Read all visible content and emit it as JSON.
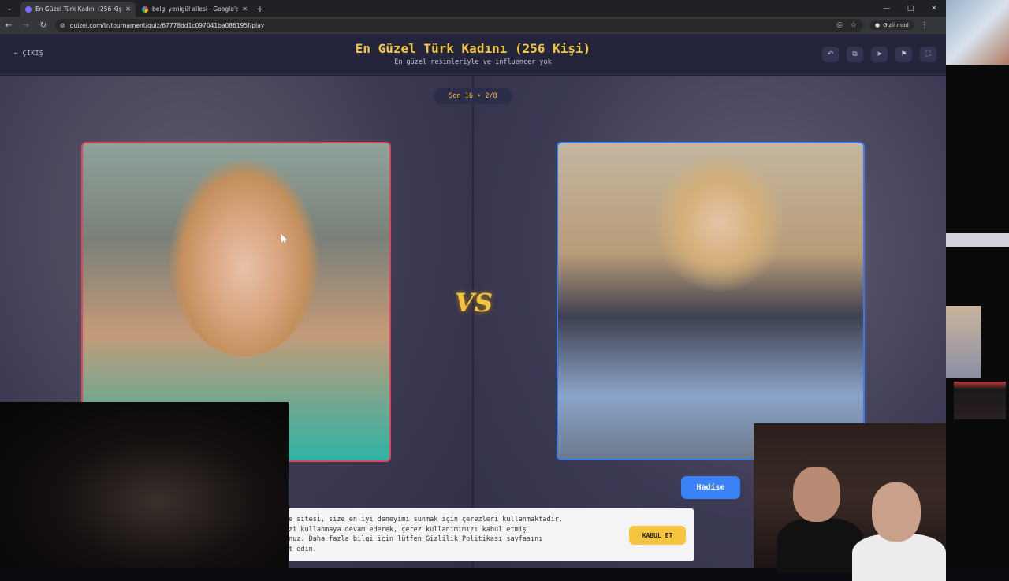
{
  "browser": {
    "tabs": [
      {
        "title": "En Güzel Türk Kadını (256 Kişi)",
        "active": true
      },
      {
        "title": "belgi yenigül ailesi - Google'da",
        "active": false
      }
    ],
    "url": "quizei.com/tr/tournament/quiz/67778dd1c097041ba086195f/play",
    "incognito_label": "Gizli mod"
  },
  "header": {
    "back_label": "ÇIKIŞ",
    "title": "En Güzel Türk Kadını (256 Kişi)",
    "subtitle": "En güzel resimleriyle ve influencer yok",
    "icons": [
      "undo-icon",
      "share-icon",
      "send-icon",
      "flag-icon",
      "fullscreen-icon"
    ]
  },
  "game": {
    "round_label": "Son 16 • 2/8",
    "vs_label": "VS",
    "right_name": "Hadise"
  },
  "cookie": {
    "text_line1": "e sitesi, size en iyi deneyimi sunmak için çerezleri kullanmaktadır.",
    "text_line2": "zi kullanmaya devam ederek, çerez kullanımımızı kabul etmiş",
    "text_line3_pre": "nuz. Daha fazla bilgi için lütfen ",
    "policy_link": "Gizlilik Politikası",
    "text_line3_post": " sayfasını",
    "text_line4": "t edin.",
    "accept_label": "KABUL ET"
  },
  "colors": {
    "accent": "#f5c542",
    "left_border": "#e0455a",
    "right_border": "#3a7cf0",
    "name_button": "#3b82f6"
  }
}
